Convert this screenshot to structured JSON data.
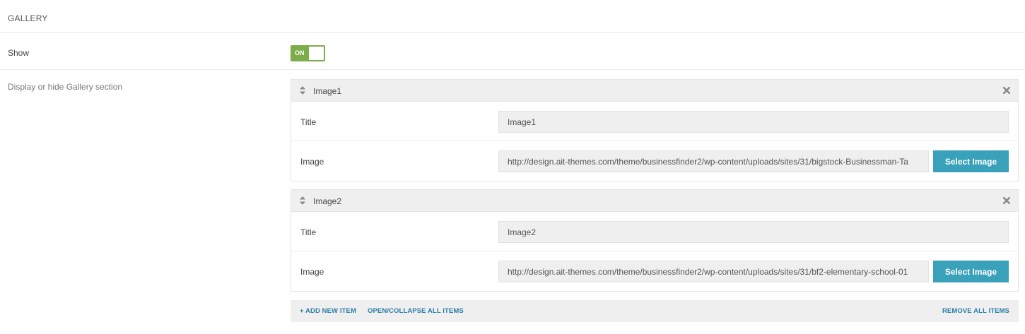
{
  "section": {
    "title": "GALLERY"
  },
  "show": {
    "label": "Show",
    "toggle_text": "ON",
    "description": "Display or hide Gallery section"
  },
  "items": [
    {
      "name": "Image1",
      "title_label": "Title",
      "title_value": "Image1",
      "image_label": "Image",
      "image_value": "http://design.ait-themes.com/theme/businessfinder2/wp-content/uploads/sites/31/bigstock-Businessman-Ta",
      "select_label": "Select Image"
    },
    {
      "name": "Image2",
      "title_label": "Title",
      "title_value": "Image2",
      "image_label": "Image",
      "image_value": "http://design.ait-themes.com/theme/businessfinder2/wp-content/uploads/sites/31/bf2-elementary-school-01",
      "select_label": "Select Image"
    }
  ],
  "footer": {
    "add_label": "+ ADD NEW ITEM",
    "toggle_all_label": "OPEN/COLLAPSE ALL ITEMS",
    "remove_all_label": "REMOVE ALL ITEMS"
  },
  "colors": {
    "toggle_on": "#7dac4a",
    "button": "#3aa1bb",
    "link": "#2b7ea8"
  }
}
